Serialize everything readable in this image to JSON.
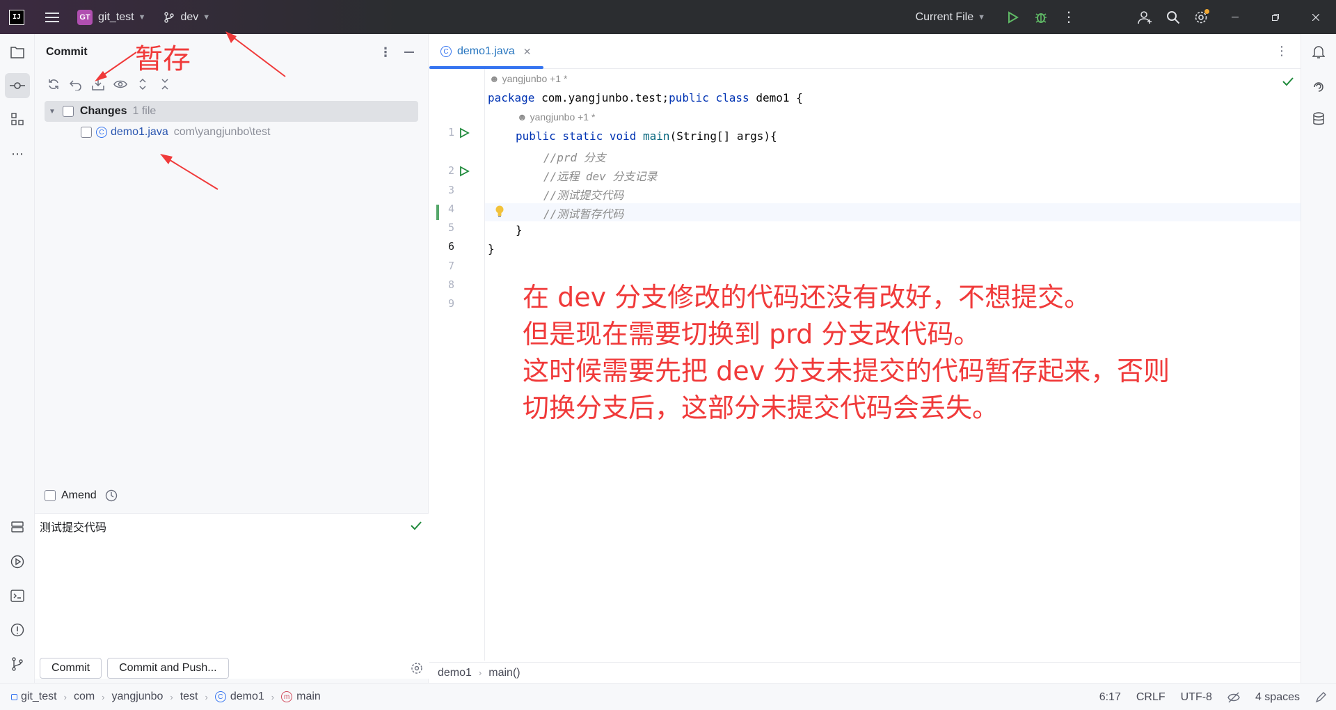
{
  "titlebar": {
    "app_logo": "IJ",
    "project_badge": "GT",
    "project_name": "git_test",
    "branch": "dev",
    "run_config": "Current File"
  },
  "commit_panel": {
    "title": "Commit",
    "changes_label": "Changes",
    "changes_count": "1 file",
    "file_name": "demo1.java",
    "file_path": "com\\yangjunbo\\test",
    "amend_label": "Amend",
    "message": "测试提交代码",
    "commit_button": "Commit",
    "commit_push_button": "Commit and Push..."
  },
  "editor": {
    "tab_label": "demo1.java",
    "author_line1": "yangjunbo +1 *",
    "author_line2": "yangjunbo +1 *",
    "line_numbers": [
      "1",
      "2",
      "3",
      "4",
      "5",
      "6",
      "7",
      "8",
      "9"
    ],
    "code": {
      "l1_kw1": "package",
      "l1_pkg": " com.yangjunbo.test;",
      "l1_kw2": "public class",
      "l1_name": " demo1 {",
      "l2_kw": "public static void",
      "l2_fn": "main",
      "l2_rest": "(String[] args){",
      "l3": "//prd 分支",
      "l4": "//远程 dev 分支记录",
      "l5": "//测试提交代码",
      "l6": "//测试暂存代码",
      "l7": "}",
      "l8": "}"
    },
    "breadcrumb": [
      "demo1",
      "main()"
    ],
    "annotation": [
      "在 dev 分支修改的代码还没有改好，不想提交。",
      "但是现在需要切换到 prd 分支改代码。",
      "这时候需要先把 dev 分支未提交的代码暂存起来，否则",
      "切换分支后，这部分未提交代码会丢失。"
    ]
  },
  "overlay": {
    "stash_label": "暂存"
  },
  "statusbar": {
    "crumbs": [
      "git_test",
      "com",
      "yangjunbo",
      "test",
      "demo1",
      "main"
    ],
    "position": "6:17",
    "line_sep": "CRLF",
    "encoding": "UTF-8",
    "indent": "4 spaces"
  },
  "colors": {
    "accent": "#3574f0",
    "annotation": "#f03a3a",
    "run_green": "#208a3c"
  }
}
